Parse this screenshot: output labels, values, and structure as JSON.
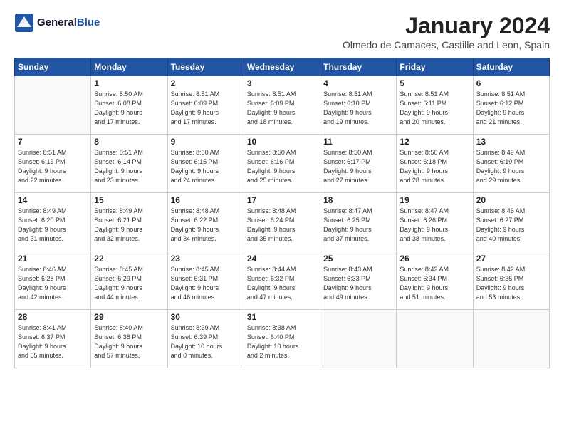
{
  "header": {
    "logo_line1": "General",
    "logo_line2": "Blue",
    "title": "January 2024",
    "subtitle": "Olmedo de Camaces, Castille and Leon, Spain"
  },
  "weekdays": [
    "Sunday",
    "Monday",
    "Tuesday",
    "Wednesday",
    "Thursday",
    "Friday",
    "Saturday"
  ],
  "weeks": [
    [
      {
        "day": "",
        "info": ""
      },
      {
        "day": "1",
        "info": "Sunrise: 8:50 AM\nSunset: 6:08 PM\nDaylight: 9 hours\nand 17 minutes."
      },
      {
        "day": "2",
        "info": "Sunrise: 8:51 AM\nSunset: 6:09 PM\nDaylight: 9 hours\nand 17 minutes."
      },
      {
        "day": "3",
        "info": "Sunrise: 8:51 AM\nSunset: 6:09 PM\nDaylight: 9 hours\nand 18 minutes."
      },
      {
        "day": "4",
        "info": "Sunrise: 8:51 AM\nSunset: 6:10 PM\nDaylight: 9 hours\nand 19 minutes."
      },
      {
        "day": "5",
        "info": "Sunrise: 8:51 AM\nSunset: 6:11 PM\nDaylight: 9 hours\nand 20 minutes."
      },
      {
        "day": "6",
        "info": "Sunrise: 8:51 AM\nSunset: 6:12 PM\nDaylight: 9 hours\nand 21 minutes."
      }
    ],
    [
      {
        "day": "7",
        "info": "Sunrise: 8:51 AM\nSunset: 6:13 PM\nDaylight: 9 hours\nand 22 minutes."
      },
      {
        "day": "8",
        "info": "Sunrise: 8:51 AM\nSunset: 6:14 PM\nDaylight: 9 hours\nand 23 minutes."
      },
      {
        "day": "9",
        "info": "Sunrise: 8:50 AM\nSunset: 6:15 PM\nDaylight: 9 hours\nand 24 minutes."
      },
      {
        "day": "10",
        "info": "Sunrise: 8:50 AM\nSunset: 6:16 PM\nDaylight: 9 hours\nand 25 minutes."
      },
      {
        "day": "11",
        "info": "Sunrise: 8:50 AM\nSunset: 6:17 PM\nDaylight: 9 hours\nand 27 minutes."
      },
      {
        "day": "12",
        "info": "Sunrise: 8:50 AM\nSunset: 6:18 PM\nDaylight: 9 hours\nand 28 minutes."
      },
      {
        "day": "13",
        "info": "Sunrise: 8:49 AM\nSunset: 6:19 PM\nDaylight: 9 hours\nand 29 minutes."
      }
    ],
    [
      {
        "day": "14",
        "info": "Sunrise: 8:49 AM\nSunset: 6:20 PM\nDaylight: 9 hours\nand 31 minutes."
      },
      {
        "day": "15",
        "info": "Sunrise: 8:49 AM\nSunset: 6:21 PM\nDaylight: 9 hours\nand 32 minutes."
      },
      {
        "day": "16",
        "info": "Sunrise: 8:48 AM\nSunset: 6:22 PM\nDaylight: 9 hours\nand 34 minutes."
      },
      {
        "day": "17",
        "info": "Sunrise: 8:48 AM\nSunset: 6:24 PM\nDaylight: 9 hours\nand 35 minutes."
      },
      {
        "day": "18",
        "info": "Sunrise: 8:47 AM\nSunset: 6:25 PM\nDaylight: 9 hours\nand 37 minutes."
      },
      {
        "day": "19",
        "info": "Sunrise: 8:47 AM\nSunset: 6:26 PM\nDaylight: 9 hours\nand 38 minutes."
      },
      {
        "day": "20",
        "info": "Sunrise: 8:46 AM\nSunset: 6:27 PM\nDaylight: 9 hours\nand 40 minutes."
      }
    ],
    [
      {
        "day": "21",
        "info": "Sunrise: 8:46 AM\nSunset: 6:28 PM\nDaylight: 9 hours\nand 42 minutes."
      },
      {
        "day": "22",
        "info": "Sunrise: 8:45 AM\nSunset: 6:29 PM\nDaylight: 9 hours\nand 44 minutes."
      },
      {
        "day": "23",
        "info": "Sunrise: 8:45 AM\nSunset: 6:31 PM\nDaylight: 9 hours\nand 46 minutes."
      },
      {
        "day": "24",
        "info": "Sunrise: 8:44 AM\nSunset: 6:32 PM\nDaylight: 9 hours\nand 47 minutes."
      },
      {
        "day": "25",
        "info": "Sunrise: 8:43 AM\nSunset: 6:33 PM\nDaylight: 9 hours\nand 49 minutes."
      },
      {
        "day": "26",
        "info": "Sunrise: 8:42 AM\nSunset: 6:34 PM\nDaylight: 9 hours\nand 51 minutes."
      },
      {
        "day": "27",
        "info": "Sunrise: 8:42 AM\nSunset: 6:35 PM\nDaylight: 9 hours\nand 53 minutes."
      }
    ],
    [
      {
        "day": "28",
        "info": "Sunrise: 8:41 AM\nSunset: 6:37 PM\nDaylight: 9 hours\nand 55 minutes."
      },
      {
        "day": "29",
        "info": "Sunrise: 8:40 AM\nSunset: 6:38 PM\nDaylight: 9 hours\nand 57 minutes."
      },
      {
        "day": "30",
        "info": "Sunrise: 8:39 AM\nSunset: 6:39 PM\nDaylight: 10 hours\nand 0 minutes."
      },
      {
        "day": "31",
        "info": "Sunrise: 8:38 AM\nSunset: 6:40 PM\nDaylight: 10 hours\nand 2 minutes."
      },
      {
        "day": "",
        "info": ""
      },
      {
        "day": "",
        "info": ""
      },
      {
        "day": "",
        "info": ""
      }
    ]
  ]
}
